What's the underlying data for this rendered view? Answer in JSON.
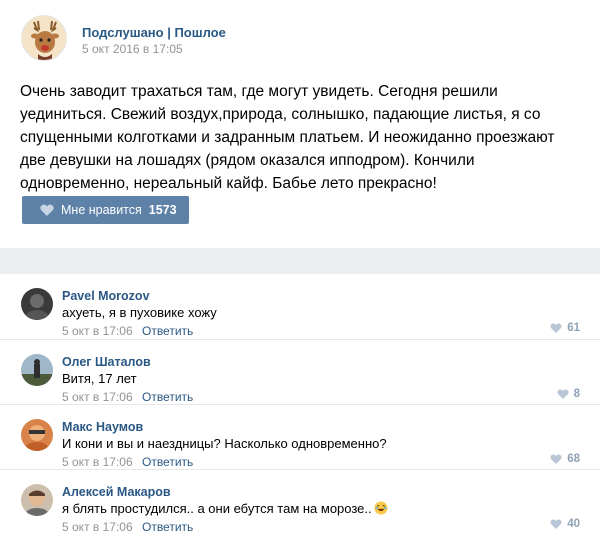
{
  "post": {
    "author": "Подслушано | Пошлое",
    "date": "5 окт 2016 в 17:05",
    "text": "Очень заводит трахаться там, где могут увидеть. Сегодня решили уединиться. Свежий воздух,природа, солнышко, падающие листья, я со спущенными колготками и задранным платьем. И неожиданно проезжают две девушки на лошадях (рядом оказался ипподром). Кончили одновременно, нереальный кайф. Бабье лето прекрасно!",
    "like_label": "Мне нравится",
    "like_count": "1573",
    "colors": {
      "link": "#2a5885",
      "button": "#5e81a8",
      "separator": "#edeef0",
      "meta": "#939393"
    }
  },
  "comments": [
    {
      "author": "Pavel Morozov",
      "text": "ахуеть, я в пуховике хожу",
      "date": "5 окт в 17:06",
      "reply_label": "Ответить",
      "likes": "61"
    },
    {
      "author": "Олег Шаталов",
      "text": "Витя, 17 лет",
      "date": "5 окт в 17:06",
      "reply_label": "Ответить",
      "likes": "8"
    },
    {
      "author": "Макс Наумов",
      "text": "И кони и вы и наездницы? Насколько одновременно?",
      "date": "5 окт в 17:06",
      "reply_label": "Ответить",
      "likes": "68"
    },
    {
      "author": "Алексей Макаров",
      "text": "я блять простудился.. а они ебутся там на морозе..",
      "date": "5 окт в 17:06",
      "reply_label": "Ответить",
      "likes": "40",
      "emoji": "laughing-face-icon"
    }
  ]
}
